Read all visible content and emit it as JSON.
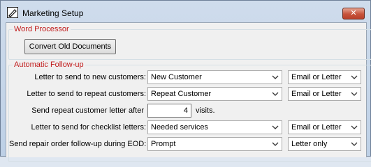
{
  "window": {
    "title": "Marketing Setup",
    "close_glyph": "✕"
  },
  "word_processor": {
    "heading": "Word Processor",
    "convert_button": "Convert Old Documents"
  },
  "follow_up": {
    "heading": "Automatic Follow-up",
    "new_customers": {
      "label": "Letter to send to new customers:",
      "letter": "New Customer",
      "method": "Email or Letter"
    },
    "repeat_customers": {
      "label": "Letter to send to repeat customers:",
      "letter": "Repeat Customer",
      "method": "Email or Letter"
    },
    "repeat_after": {
      "label": "Send repeat customer letter after",
      "value": "4",
      "unit": "visits."
    },
    "checklist": {
      "label": "Letter to send for checklist letters:",
      "letter": "Needed services",
      "method": "Email or Letter"
    },
    "repair_order": {
      "label": "Send repair order follow-up during EOD:",
      "letter": "Prompt",
      "method": "Letter only"
    }
  },
  "icons": {
    "app": "document-pen-icon",
    "close": "close-icon",
    "dropdown": "chevron-down-icon"
  },
  "colors": {
    "section_heading": "#c01818",
    "close_button": "#c7533b"
  }
}
